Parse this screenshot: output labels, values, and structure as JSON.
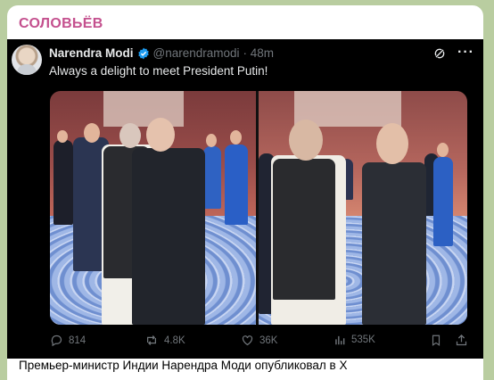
{
  "channel": {
    "name": "СОЛОВЬЁВ"
  },
  "tweet": {
    "author_name": "Narendra Modi",
    "handle": "@narendramodi",
    "time": "· 48m",
    "text": "Always a delight to meet President Putin!",
    "icons": [
      "verified-badge-icon",
      "grok-icon",
      "more-icon"
    ]
  },
  "media": {
    "photo_count": 2
  },
  "actions": {
    "replies": "814",
    "reposts": "4.8K",
    "likes": "36K",
    "views": "535K",
    "icons": [
      "reply-icon",
      "repost-icon",
      "like-icon",
      "views-icon",
      "bookmark-icon",
      "share-icon"
    ]
  },
  "caption": {
    "text": "Премьер-министр Индии Нарендра Моди опубликовал в X"
  },
  "colors": {
    "channel_name": "#c4508e",
    "tweet_bg": "#000000",
    "verified": "#1d9bf0",
    "muted": "#71767b",
    "chat_bg": "#b9cda0"
  }
}
